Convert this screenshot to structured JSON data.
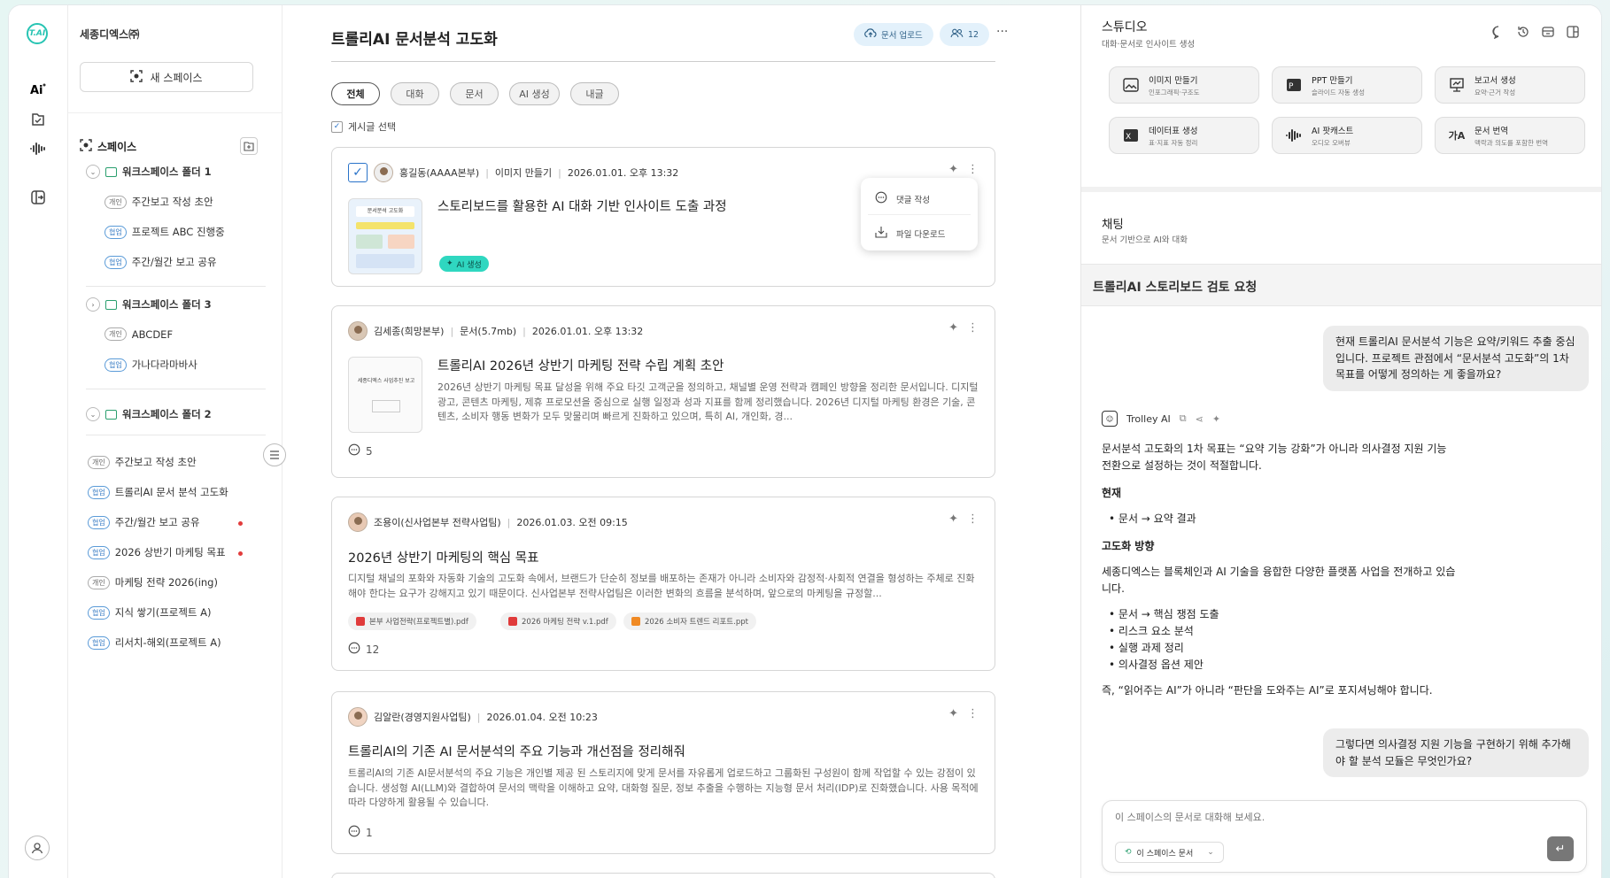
{
  "rail": {
    "logo_text": "T.AI",
    "icons": [
      "ai-icon",
      "check-doc-icon",
      "audio-wave-icon",
      "login-icon",
      "user-icon"
    ]
  },
  "sidebar": {
    "org_name": "세종디엑스㈜",
    "new_space_label": "새 스페이스",
    "spaces_label": "스페이스",
    "folder1": {
      "name": "워크스페이스 폴더 1",
      "items": [
        {
          "tag": "개인",
          "label": "주간보고 작성 초안"
        },
        {
          "tag": "협업",
          "label": "프로젝트 ABC 진행중"
        },
        {
          "tag": "협업",
          "label": "주간/월간 보고 공유"
        }
      ]
    },
    "folder3": {
      "name": "워크스페이스 폴더 3",
      "items": [
        {
          "tag": "개인",
          "label": "ABCDEF"
        },
        {
          "tag": "협업",
          "label": "가나다라마바사"
        }
      ]
    },
    "folder2": {
      "name": "워크스페이스 폴더 2"
    },
    "loose_items": [
      {
        "tag": "개인",
        "label": "주간보고 작성 초안"
      },
      {
        "tag": "협업",
        "label": "트롤리AI 문서 분석 고도화"
      },
      {
        "tag": "협업",
        "label": "주간/월간 보고 공유"
      },
      {
        "tag": "협업",
        "label": "2026 상반기 마케팅 목표"
      },
      {
        "tag": "개인",
        "label": "마케팅 전략 2026(ing)"
      },
      {
        "tag": "협업",
        "label": "지식 쌓기(프로젝트 A)"
      },
      {
        "tag": "협업",
        "label": "리서치-해외(프로젝트 A)"
      }
    ]
  },
  "main": {
    "title": "트롤리AI 문서분석 고도화",
    "upload_label": "문서 업로드",
    "member_count": "12",
    "filters": [
      "전체",
      "대화",
      "문서",
      "AI 생성",
      "내글"
    ],
    "select_label": "게시글 선택",
    "popup": {
      "comment": "댓글 작성",
      "download": "파일 다운로드"
    },
    "posts": [
      {
        "author": "홍길동(AAAA본부)",
        "type": "이미지 만들기",
        "date": "2026.01.01. 오후 13:32",
        "title": "스토리보드를 활용한 AI 대화 기반 인사이트 도출 과정",
        "badge": "AI 생성",
        "thumb_caption": "문서분석 고도화"
      },
      {
        "author": "김세종(희망본부)",
        "type": "문서(5.7mb)",
        "date": "2026.01.01. 오후 13:32",
        "title": "트롤리AI 2026년 상반기 마케팅 전략 수립 계획 초안",
        "body": "2026년 상반기 마케팅 목표 달성을 위해 주요 타깃 고객군을 정의하고, 채널별 운영 전략과 캠페인 방향을 정리한 문서입니다. 디지털 광고, 콘텐츠 마케팅, 제휴 프로모션을 중심으로 실행 일정과 성과 지표를 함께 정리했습니다. 2026년 디지털 마케팅 환경은 기술, 콘텐츠, 소비자 행동 변화가 모두 맞물리며 빠르게 진화하고 있으며, 특히 AI, 개인화, 경...",
        "comments": "5",
        "thumb_caption": "세종디엑스 사업추진 보고"
      },
      {
        "author": "조용이(신사업본부 전략사업팀)",
        "date": "2026.01.03. 오전 09:15",
        "title": "2026년 상반기 마케팅의 핵심 목표",
        "body": "디지털 채널의 포화와 자동화 기술의 고도화 속에서, 브랜드가 단순히 정보를 배포하는 존재가 아니라 소비자와 감정적·사회적 연결을 형성하는 주체로 진화해야 한다는 요구가 강해지고 있기 때문이다. 신사업본부 전략사업팀은 이러한 변화의 흐름을 분석하며, 앞으로의 마케팅을 규정할...",
        "files": [
          "본부 사업전략(프로젝트별).pdf",
          "2026 마케팅 전략 v.1.pdf",
          "2026 소비자 트렌드 리포트.ppt"
        ],
        "comments": "12"
      },
      {
        "author": "김알란(경영지원사업팀)",
        "date": "2026.01.04. 오전 10:23",
        "title": "트롤리AI의 기존 AI 문서분석의 주요 기능과 개선점을 정리해줘",
        "body": "트롤리AI의 기존 AI문서분석의 주요 기능은 개인별 제공 된 스토리지에 맞게 문서를 자유롭게 업로드하고 그룹화된 구성원이 함께 작업할 수 있는 강점이 있습니다. 생성형 AI(LLM)와 결합하여 문서의 맥락을 이해하고 요약, 대화형 질문, 정보 추출을 수행하는 지능형 문서 처리(IDP)로 진화했습니다. 사용 목적에 따라 다양하게 활용될 수 있습니다.",
        "comments": "1"
      }
    ]
  },
  "studio": {
    "title": "스튜디오",
    "subtitle": "대화·문서로 인사이트 생성",
    "tools": [
      {
        "label": "이미지 만들기",
        "sub": "인포그래픽·구조도",
        "icon": "image-icon"
      },
      {
        "label": "PPT 만들기",
        "sub": "슬라이드 자동 생성",
        "icon": "ppt-icon"
      },
      {
        "label": "보고서 생성",
        "sub": "요약·근거 작성",
        "icon": "report-icon"
      },
      {
        "label": "데이터표 생성",
        "sub": "표·지표 자동 정리",
        "icon": "excel-icon"
      },
      {
        "label": "AI 팟캐스트",
        "sub": "오디오 오버뷰",
        "icon": "podcast-icon"
      },
      {
        "label": "문서 번역",
        "sub": "맥락과 의도를 포함한 번역",
        "icon": "translate-icon"
      }
    ],
    "chat_title": "채팅",
    "chat_sub": "문서 기반으로 AI와 대화",
    "conversation_title": "트롤리AI 스토리보드 검토 요청",
    "user_msg1": "현재 트롤리AI 문서분석 기능은 요약/키워드 추출 중심입니다. 프로젝트 관점에서 “문서분석 고도화”의 1차 목표를 어떻게 정의하는 게 좋을까요?",
    "bot_name": "Trolley AI",
    "answer_intro": "문서분석 고도화의 1차 목표는 “요약 기능 강화”가 아니라 의사결정 지원 기능 전환으로 설정하는 것이 적절합니다.",
    "answer_h1": "현재",
    "answer_current": "문서 → 요약 결과",
    "answer_h2": "고도화 방향",
    "answer_para": "세종디엑스는 블록체인과 AI 기술을 융합한 다양한 플랫폼 사업을 전개하고 있습니다.",
    "answer_list": [
      "문서 → 핵심 쟁점 도출",
      "리스크 요소 분석",
      "실행 과제 정리",
      "의사결정 옵션 제안"
    ],
    "answer_outro": "즉, “읽어주는 AI”가 아니라 “판단을 도와주는 AI”로 포지셔닝해야 합니다.",
    "user_msg2": "그렇다면 의사결정 지원 기능을 구현하기 위해 추가해야 할 분석 모듈은 무엇인가요?",
    "input_placeholder": "이 스페이스의 문서로 대화해 보세요.",
    "scope_label": "이 스페이스 문서"
  },
  "colors": {
    "accent": "#27c4b3",
    "ai_badge": "#2fd7c0",
    "chip_bg": "#e3f1fb",
    "red_dot": "#e23c3c"
  }
}
